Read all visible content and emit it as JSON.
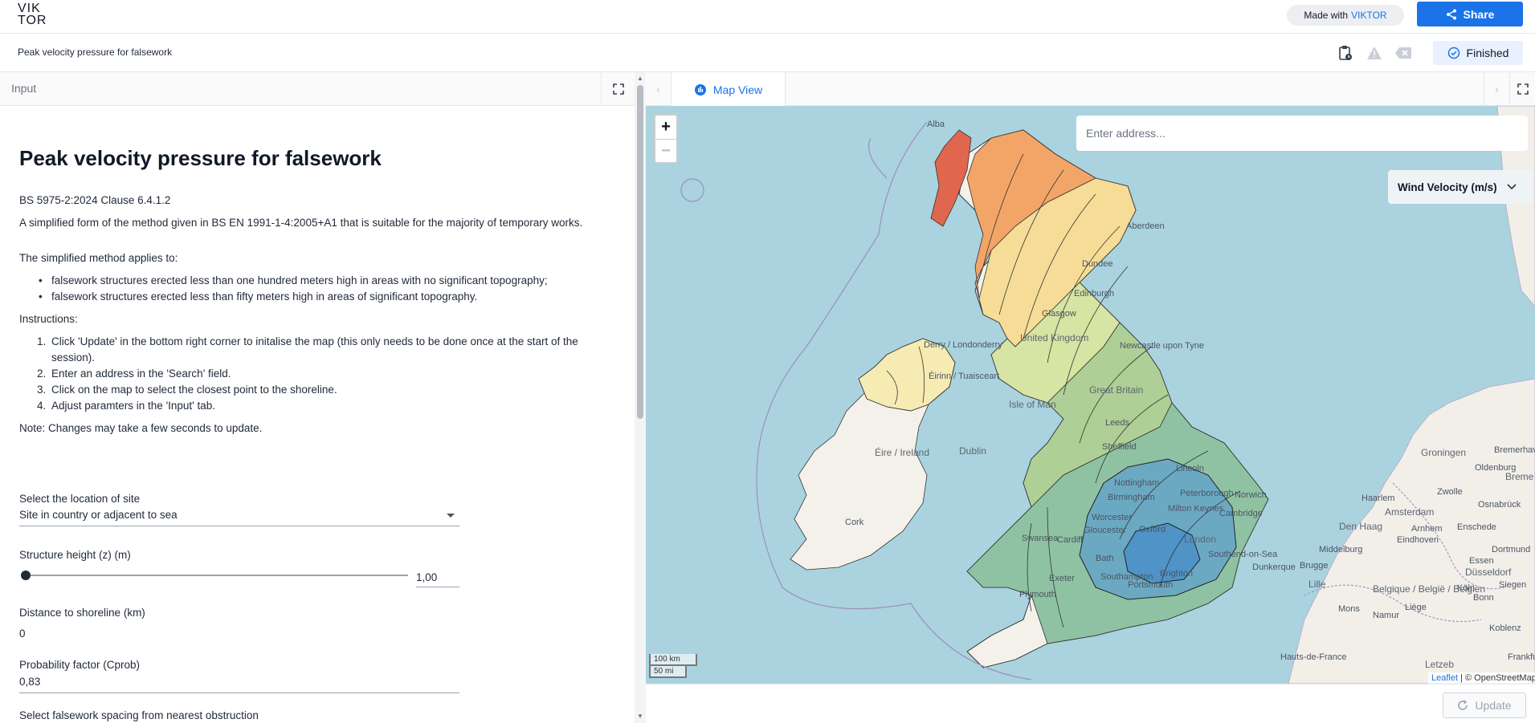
{
  "topbar": {
    "logo_line1": "VIK",
    "logo_line2": "TOR",
    "made_with_label": "Made with",
    "made_with_brand": "VIKTOR",
    "share_label": "Share"
  },
  "subbar": {
    "app_title": "Peak velocity pressure for falsework",
    "status_label": "Finished"
  },
  "left_panel": {
    "tab_label": "Input",
    "heading": "Peak velocity pressure for falsework",
    "clause": "BS 5975-2:2024 Clause 6.4.1.2",
    "intro": "A simplified form of the method given in BS EN 1991-1-4:2005+A1 that is suitable for the majority of temporary works.",
    "applies_to": "The simplified method applies to:",
    "bullets": [
      "falsework structures erected less than one hundred meters high in areas with no significant topography;",
      "falsework structures erected less than fifty meters high in areas of significant topography."
    ],
    "instructions_label": "Instructions:",
    "steps": [
      {
        "n": "1.",
        "text": "Click 'Update' in the bottom right corner to initalise the map (this only needs to be done once at the start of the session)."
      },
      {
        "n": "2.",
        "text": "Enter an address in the 'Search' field."
      },
      {
        "n": "3.",
        "text": "Click on the map to select the closest point to the shoreline."
      },
      {
        "n": "4.",
        "text": "Adjust paramters in the 'Input' tab."
      }
    ],
    "note": "Note: Changes may take a few seconds to update.",
    "fields": {
      "location_label": "Select the location of site",
      "location_value": "Site in country or adjacent to sea",
      "height_label": "Structure height (z) (m)",
      "height_value": "1,00",
      "height_fraction": 0,
      "distance_label": "Distance to shoreline (km)",
      "distance_value": "0",
      "prob_label": "Probability factor (Cprob)",
      "prob_value": "0,83",
      "spacing_label": "Select falsework spacing from nearest obstruction"
    }
  },
  "right_panel": {
    "tab_label": "Map View",
    "search_placeholder": "Enter address...",
    "legend_label": "Wind Velocity (m/s)",
    "zoom_in": "+",
    "zoom_out": "−",
    "scale_km": "100 km",
    "scale_mi": "50 mi",
    "attribution_link": "Leaflet",
    "attribution_text": "| © OpenStreetMap",
    "update_label": "Update",
    "map_labels": {
      "aberdeen": "Aberdeen",
      "dundee": "Dundee",
      "edinburgh": "Edinburgh",
      "glasgow": "Glasgow",
      "united_kingdom": "United Kingdom",
      "newcastle": "Newcastle upon Tyne",
      "derry": "Derry / Londonderry",
      "isle_of_man": "Isle of Man",
      "great_britain": "Great Britain",
      "leeds": "Leeds",
      "sheffield": "Sheffield",
      "eire": "Éire / Ireland",
      "dublin": "Dublin",
      "nottingham": "Nottingham",
      "lincoln": "Lincoln",
      "peterborough": "Peterborough",
      "norwich": "Norwich",
      "birmingham": "Birmingham",
      "cambridge": "Cambridge",
      "milton_keynes": "Milton Keynes",
      "worcester": "Worcester",
      "gloucester": "Gloucester",
      "oxford": "Oxford",
      "cork": "Cork",
      "swansea": "Swansea",
      "cardiff": "Cardiff",
      "london": "London",
      "southend": "Southend-on-Sea",
      "bath": "Bath",
      "southampton": "Southampton",
      "brighton": "Brighton",
      "exeter": "Exeter",
      "plymouth": "Plymouth",
      "portsmouth": "Portsmouth",
      "groningen": "Groningen",
      "oldenburg": "Oldenburg",
      "bremerhaven": "Bremerhaven",
      "bremen": "Breme",
      "zwolle": "Zwolle",
      "haarlem": "Haarlem",
      "amsterdam": "Amsterdam",
      "osnabruck": "Osnabrück",
      "den_haag": "Den Haag",
      "arnhem": "Arnhem",
      "enschede": "Enschede",
      "eindhoven": "Eindhoven",
      "middelburg": "Middelburg",
      "dortmund": "Dortmund",
      "essen": "Essen",
      "brugge": "Brugge",
      "dunkerque": "Dunkerque",
      "lille": "Lille",
      "dusseldorf": "Düsseldorf",
      "koln": "Köln",
      "bonn": "Bonn",
      "belgie": "Belgique / België / Belgien",
      "siegen": "Siegen",
      "mons": "Mons",
      "namur": "Namur",
      "liege": "Liège",
      "koblenz": "Koblenz",
      "hauts_de_france": "Hauts-de-France",
      "letzebuerg": "Letzeb",
      "frankfurt": "Frankfurt",
      "alba": "Alba",
      "ireland_ni": "Éirinn / Tuaisceart"
    }
  },
  "colors": {
    "accent": "#1a73e8",
    "sea": "#aad3df",
    "zone_red": "#e0664e",
    "zone_orange": "#f3a567",
    "zone_yellow": "#f6dc96",
    "zone_light_green": "#cfe2a3",
    "zone_green": "#a8cf97",
    "zone_teal": "#8ec3a0",
    "zone_blue": "#6aa9c4",
    "zone_dark_blue": "#4f93c7"
  }
}
